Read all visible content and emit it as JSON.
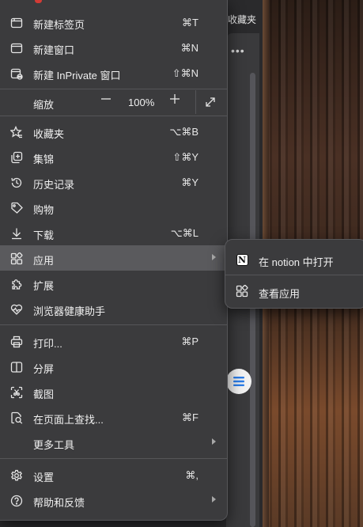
{
  "background": {
    "favorites_text": "收藏夹",
    "more_dots": "•••"
  },
  "menu": {
    "items": [
      {
        "label": "新建标签页",
        "shortcut": "⌘T",
        "icon": "new-tab-icon"
      },
      {
        "label": "新建窗口",
        "shortcut": "⌘N",
        "icon": "new-window-icon"
      },
      {
        "label": "新建 InPrivate 窗口",
        "shortcut": "⇧⌘N",
        "icon": "inprivate-window-icon"
      },
      {
        "label": "缩放",
        "icon": "none"
      },
      {
        "label": "收藏夹",
        "shortcut": "⌥⌘B",
        "icon": "favorites-star-icon"
      },
      {
        "label": "集锦",
        "shortcut": "⇧⌘Y",
        "icon": "collections-icon"
      },
      {
        "label": "历史记录",
        "shortcut": "⌘Y",
        "icon": "history-icon"
      },
      {
        "label": "购物",
        "shortcut": "",
        "icon": "shopping-tag-icon"
      },
      {
        "label": "下载",
        "shortcut": "⌥⌘L",
        "icon": "download-icon"
      },
      {
        "label": "应用",
        "shortcut": "",
        "icon": "apps-icon"
      },
      {
        "label": "扩展",
        "shortcut": "",
        "icon": "extensions-puzzle-icon"
      },
      {
        "label": "浏览器健康助手",
        "shortcut": "",
        "icon": "browser-health-icon"
      },
      {
        "label": "打印...",
        "shortcut": "⌘P",
        "icon": "print-icon"
      },
      {
        "label": "分屏",
        "shortcut": "",
        "icon": "split-screen-icon"
      },
      {
        "label": "截图",
        "shortcut": "",
        "icon": "screenshot-icon"
      },
      {
        "label": "在页面上查找...",
        "shortcut": "⌘F",
        "icon": "find-on-page-icon"
      },
      {
        "label": "更多工具",
        "shortcut": "",
        "icon": "none"
      },
      {
        "label": "设置",
        "shortcut": "⌘,",
        "icon": "settings-gear-icon"
      },
      {
        "label": "帮助和反馈",
        "shortcut": "",
        "icon": "help-icon"
      }
    ],
    "zoom": {
      "minus": "—",
      "value": "100%",
      "plus": "+"
    }
  },
  "submenu": {
    "items": [
      {
        "label": "在 notion 中打开",
        "icon": "notion-app-icon",
        "icon_glyph": "N"
      },
      {
        "label": "查看应用",
        "icon": "apps-icon"
      }
    ]
  },
  "colors": {
    "menu_bg": "#3b3b3d",
    "highlight": "#5a5a5d",
    "divider": "#555558",
    "text": "#f0f0f0"
  }
}
